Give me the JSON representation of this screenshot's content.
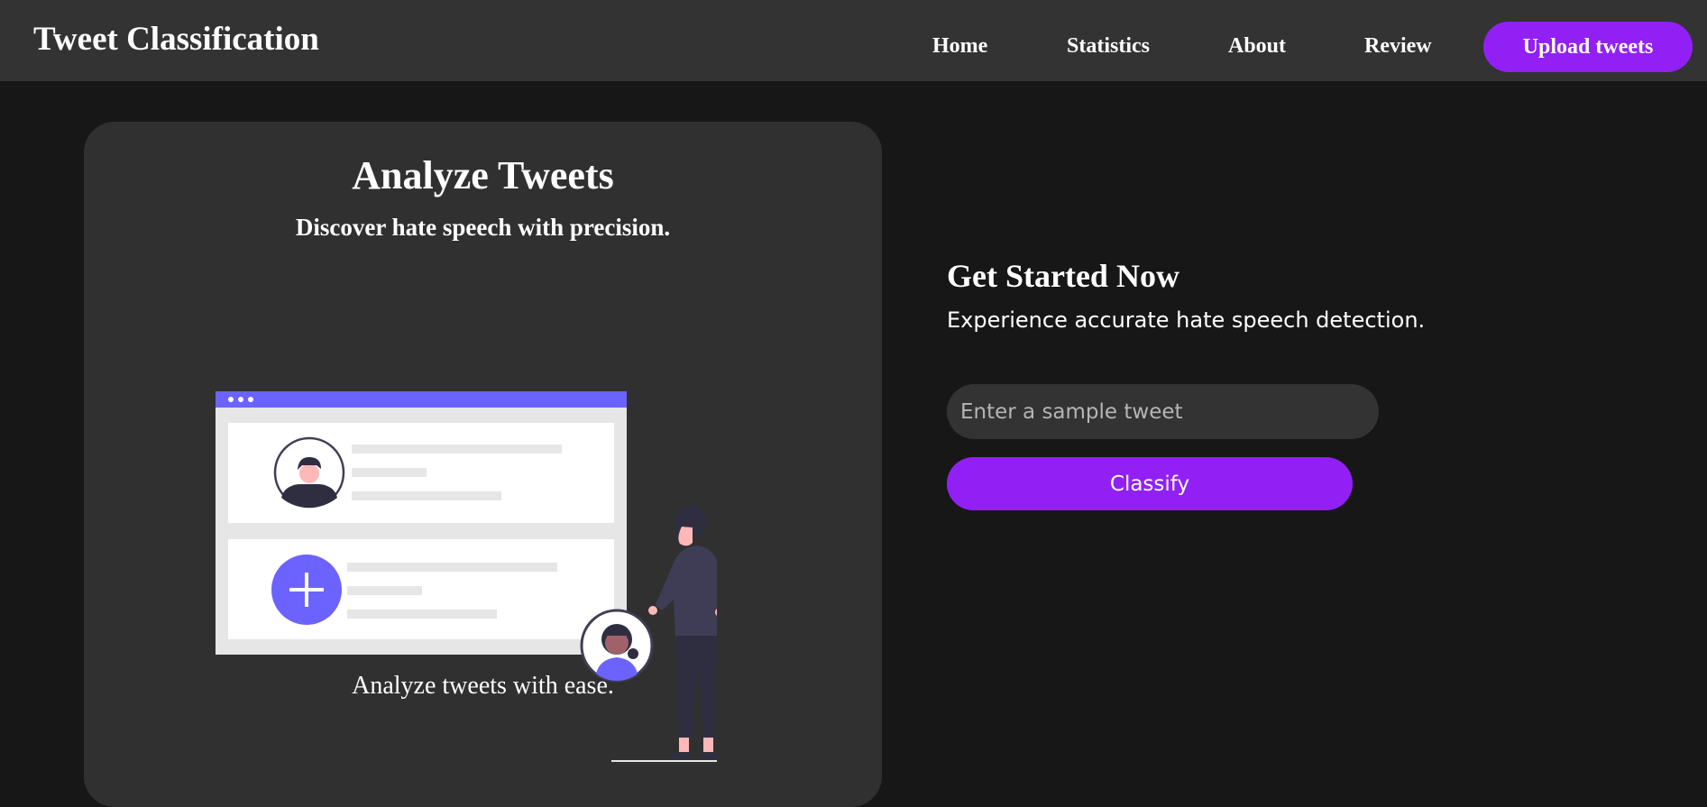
{
  "nav": {
    "brand": "Tweet Classification",
    "links": [
      "Home",
      "Statistics",
      "About",
      "Review"
    ],
    "upload_label": "Upload tweets"
  },
  "hero": {
    "title": "Analyze Tweets",
    "subtitle": "Discover hate speech with precision.",
    "caption": "Analyze tweets with ease."
  },
  "cta": {
    "title": "Get Started Now",
    "subtitle": "Experience accurate hate speech detection.",
    "input_placeholder": "Enter a sample tweet",
    "input_value": "",
    "button_label": "Classify"
  },
  "colors": {
    "accent": "#9220f5",
    "illustration_accent": "#6c63ff",
    "navbar_bg": "#333333",
    "page_bg": "#171717",
    "card_bg": "#303030"
  }
}
